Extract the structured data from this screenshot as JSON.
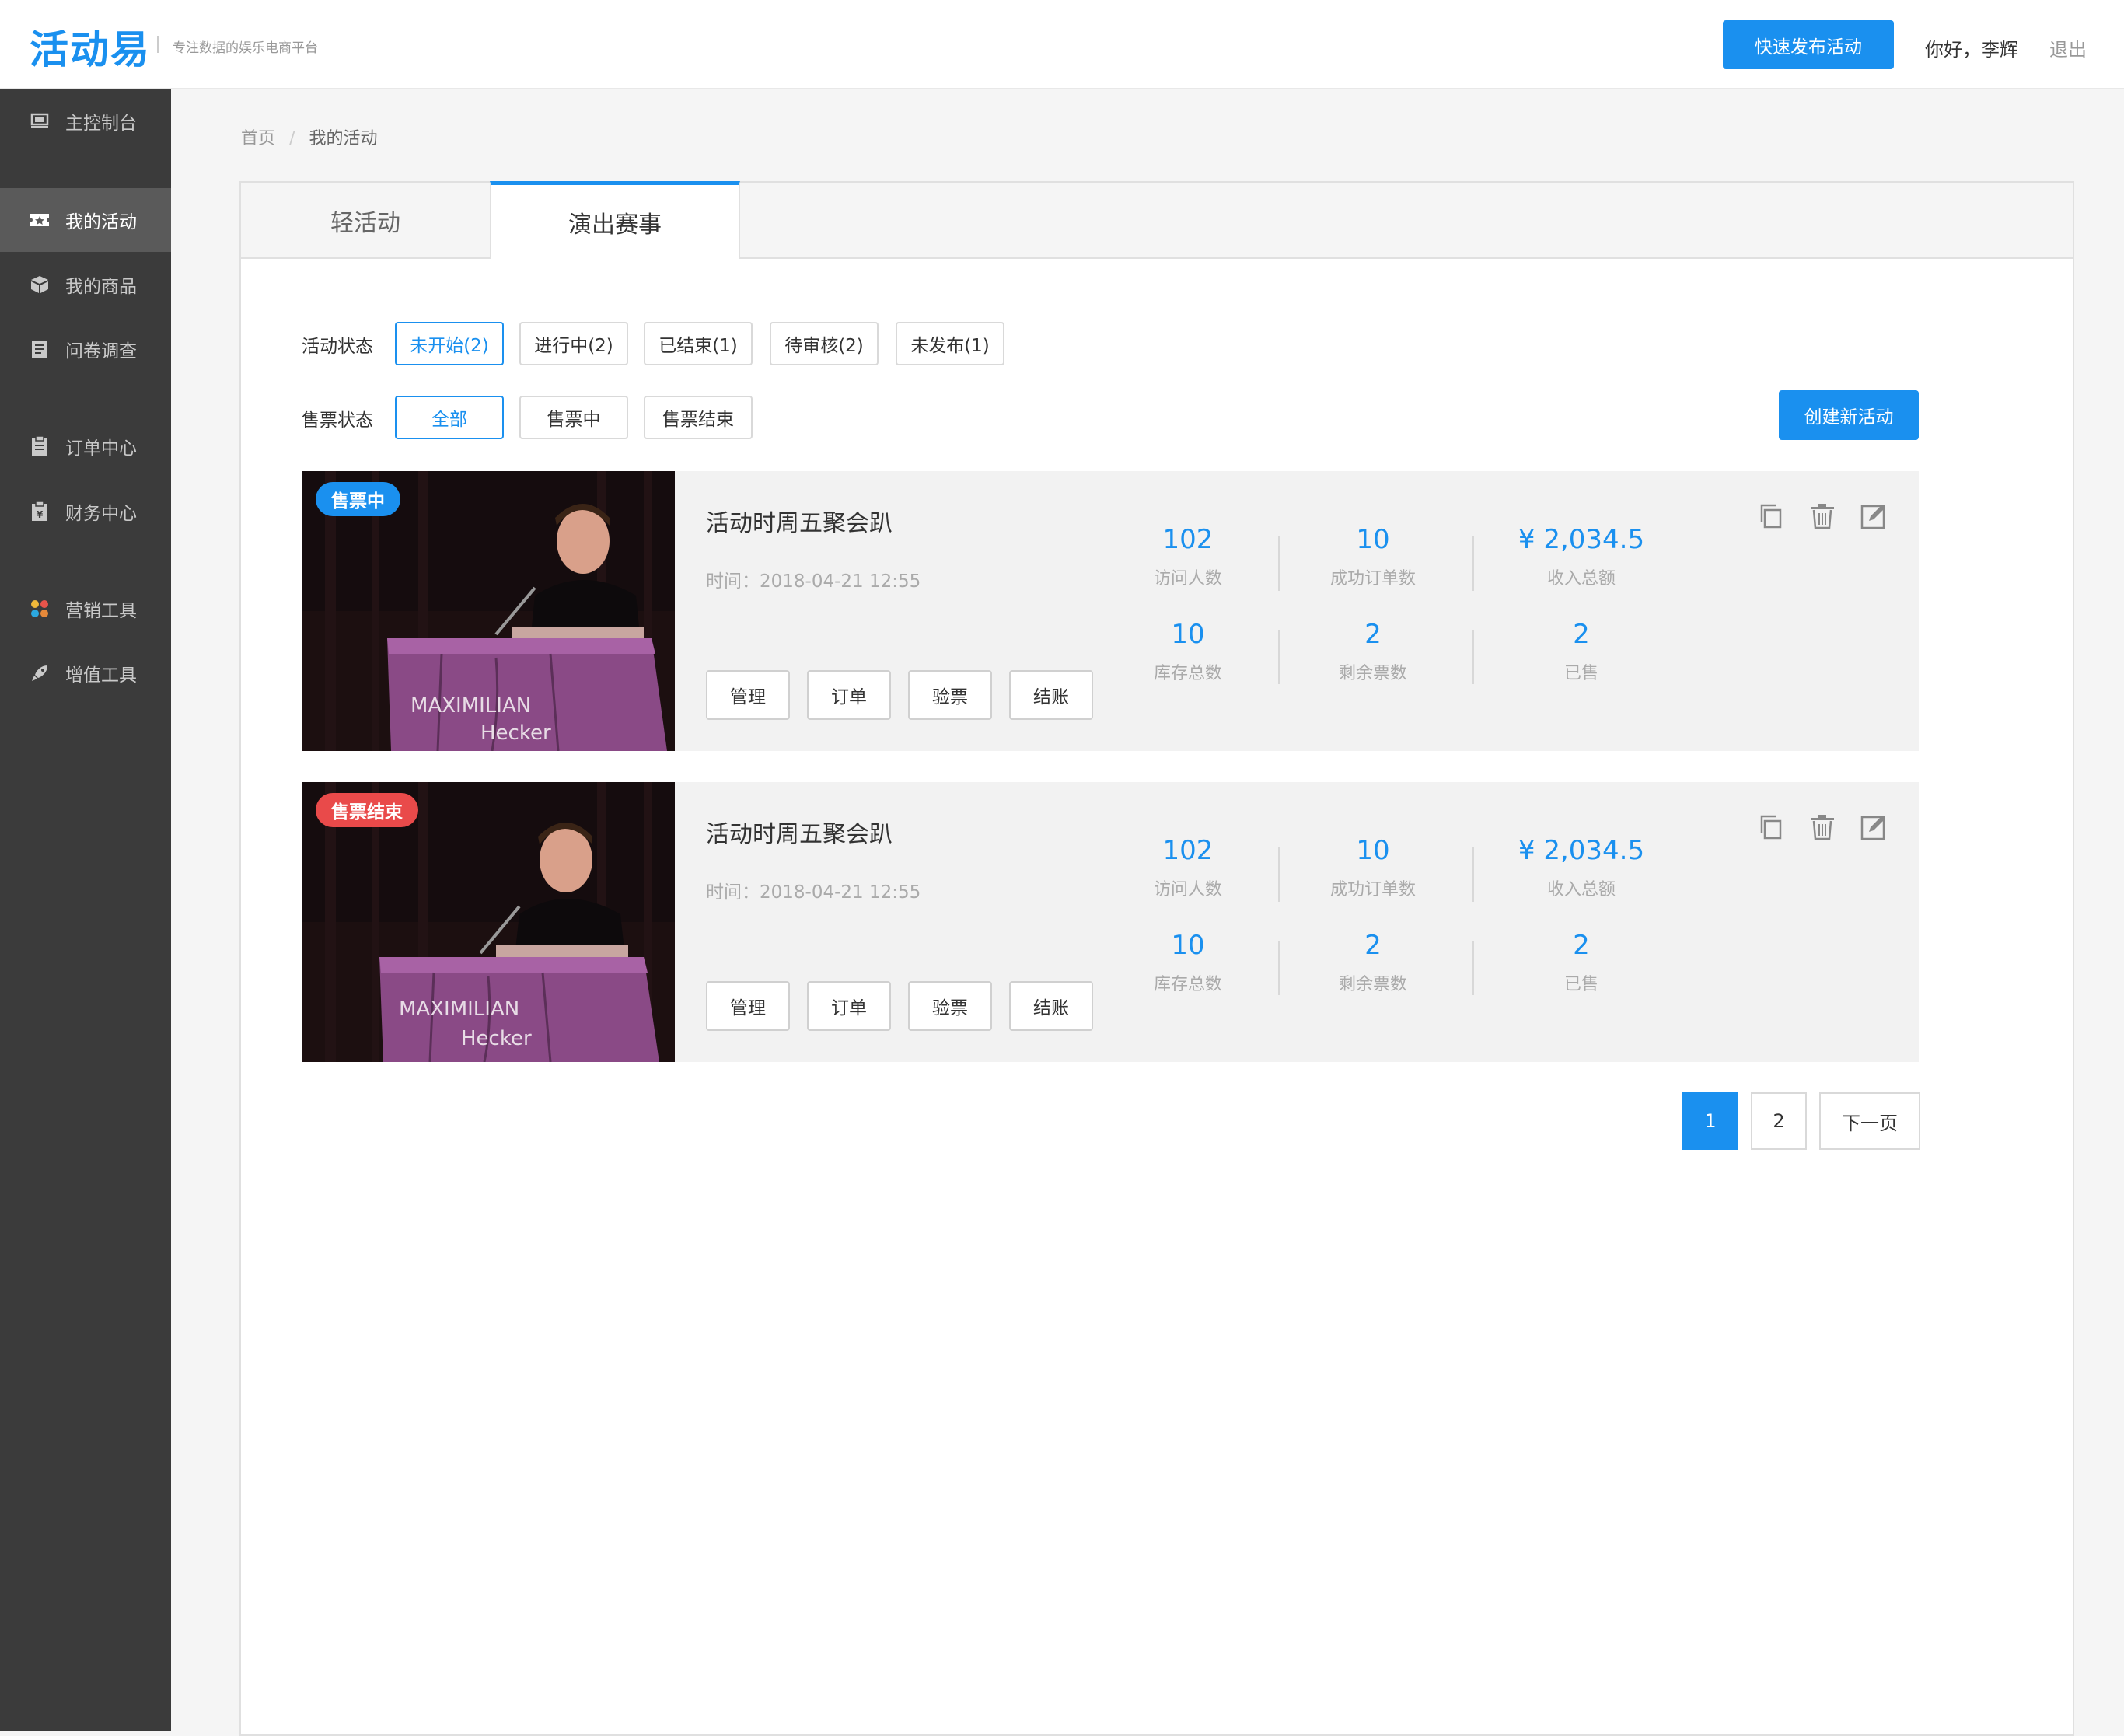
{
  "header": {
    "logo": "活动易",
    "tagline": "专注数据的娱乐电商平台",
    "quick_publish": "快速发布活动",
    "greeting": "你好，李辉",
    "logout": "退出"
  },
  "sidebar": {
    "items": [
      {
        "label": "主控制台",
        "icon": "monitor-icon"
      },
      {
        "label": "我的活动",
        "icon": "ticket-icon",
        "active": true
      },
      {
        "label": "我的商品",
        "icon": "box-icon"
      },
      {
        "label": "问卷调查",
        "icon": "form-icon"
      },
      {
        "label": "订单中心",
        "icon": "clipboard-icon"
      },
      {
        "label": "财务中心",
        "icon": "finance-icon"
      },
      {
        "label": "营销工具",
        "icon": "grid-icon"
      },
      {
        "label": "增值工具",
        "icon": "rocket-icon"
      }
    ]
  },
  "breadcrumb": {
    "home": "首页",
    "current": "我的活动"
  },
  "tabs": [
    "轻活动",
    "演出赛事"
  ],
  "filters": {
    "activity_label": "活动状态",
    "activity_options": [
      "未开始(2)",
      "进行中(2)",
      "已结束(1)",
      "待审核(2)",
      "未发布(1)"
    ],
    "activity_selected": "未开始(2)",
    "sales_label": "售票状态",
    "sales_options": [
      "全部",
      "售票中",
      "售票结束"
    ],
    "sales_selected": "全部"
  },
  "create_button": "创建新活动",
  "events": [
    {
      "badge": "售票中",
      "badge_color": "#1a90ef",
      "title": "活动时周五聚会趴",
      "time": "时间：2018-04-21  12:55",
      "image_caption_1": "MAXIMILIAN",
      "image_caption_2": "Hecker",
      "buttons": [
        "管理",
        "订单",
        "验票",
        "结账"
      ],
      "stats": [
        {
          "value": "102",
          "label": "访问人数"
        },
        {
          "value": "10",
          "label": "成功订单数"
        },
        {
          "value": "¥ 2,034.5",
          "label": "收入总额"
        },
        {
          "value": "10",
          "label": "库存总数"
        },
        {
          "value": "2",
          "label": "剩余票数"
        },
        {
          "value": "2",
          "label": "已售"
        }
      ]
    },
    {
      "badge": "售票结束",
      "badge_color": "#e94a4a",
      "title": "活动时周五聚会趴",
      "time": "时间：2018-04-21  12:55",
      "image_caption_1": "MAXIMILIAN",
      "image_caption_2": "Hecker",
      "buttons": [
        "管理",
        "订单",
        "验票",
        "结账"
      ],
      "stats": [
        {
          "value": "102",
          "label": "访问人数"
        },
        {
          "value": "10",
          "label": "成功订单数"
        },
        {
          "value": "¥ 2,034.5",
          "label": "收入总额"
        },
        {
          "value": "10",
          "label": "库存总数"
        },
        {
          "value": "2",
          "label": "剩余票数"
        },
        {
          "value": "2",
          "label": "已售"
        }
      ]
    }
  ],
  "pagination": {
    "pages": [
      "1",
      "2"
    ],
    "current": "1",
    "next": "下一页"
  },
  "colors": {
    "accent": "#1a90ef",
    "sidebar": "#3b3b3b",
    "danger": "#e94a4a"
  }
}
